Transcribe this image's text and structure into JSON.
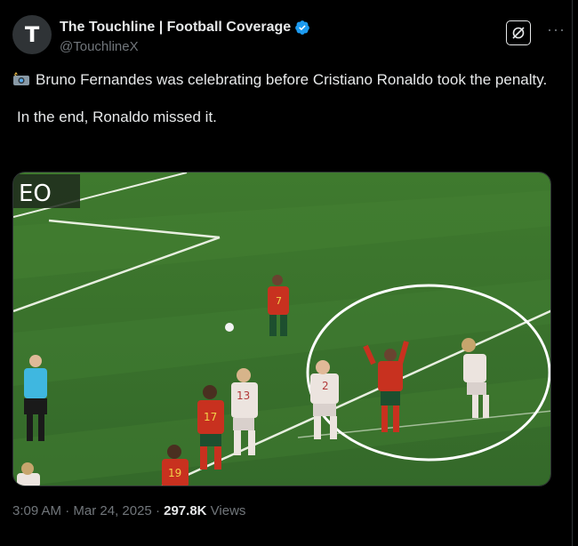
{
  "author": {
    "display_name": "The Touchline | Football Coverage",
    "handle": "@TouchlineX",
    "avatar_letter": "T",
    "verified_color": "#1d9bf0"
  },
  "tweet": {
    "line1": "Bruno Fernandes was celebrating before Cristiano Ronaldo took the penalty.",
    "line2": "In the end, Ronaldo missed it."
  },
  "media": {
    "broadcaster_logo": "EO",
    "jersey_numbers": [
      "7",
      "17",
      "13",
      "2",
      "19"
    ]
  },
  "meta": {
    "time": "3:09 AM",
    "date": "Mar 24, 2025",
    "views_count": "297.8K",
    "views_label": "Views",
    "separator": "·"
  },
  "icons": {
    "camera_flash": "camera-flash-icon",
    "verified": "verified-badge-icon",
    "grok": "grok-icon",
    "more": "more-icon"
  }
}
